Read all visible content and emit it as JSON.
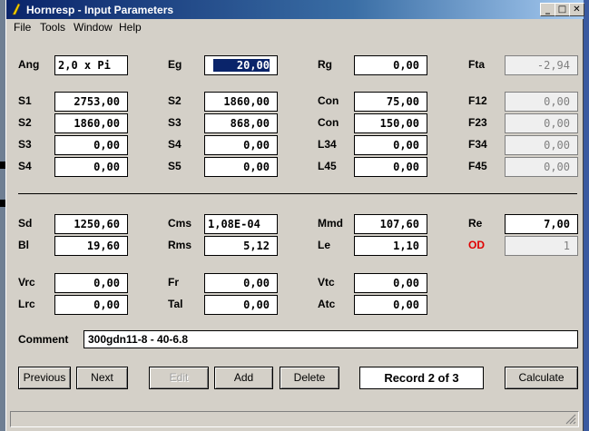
{
  "window": {
    "title": "Hornresp - Input Parameters",
    "buttons": {
      "minimize": "_",
      "maximize": "□",
      "close": "✕"
    }
  },
  "menu": [
    "File",
    "Tools",
    "Window",
    "Help"
  ],
  "params": {
    "ang": {
      "label": "Ang",
      "value": "2,0 x Pi"
    },
    "eg": {
      "label": "Eg",
      "value": "20,00"
    },
    "rg": {
      "label": "Rg",
      "value": "0,00"
    },
    "fta": {
      "label": "Fta",
      "value": "-2,94"
    },
    "s1": {
      "label": "S1",
      "value": "2753,00"
    },
    "s2a": {
      "label": "S2",
      "value": "1860,00"
    },
    "s2b": {
      "label": "S2",
      "value": "1860,00"
    },
    "s3a": {
      "label": "S3",
      "value": "868,00"
    },
    "s3b": {
      "label": "S3",
      "value": "0,00"
    },
    "s4a": {
      "label": "S4",
      "value": "0,00"
    },
    "s4b": {
      "label": "S4",
      "value": "0,00"
    },
    "s5": {
      "label": "S5",
      "value": "0,00"
    },
    "con1": {
      "label": "Con",
      "value": "75,00"
    },
    "con2": {
      "label": "Con",
      "value": "150,00"
    },
    "l34": {
      "label": "L34",
      "value": "0,00"
    },
    "l45": {
      "label": "L45",
      "value": "0,00"
    },
    "f12": {
      "label": "F12",
      "value": "0,00"
    },
    "f23": {
      "label": "F23",
      "value": "0,00"
    },
    "f34": {
      "label": "F34",
      "value": "0,00"
    },
    "f45": {
      "label": "F45",
      "value": "0,00"
    },
    "sd": {
      "label": "Sd",
      "value": "1250,60"
    },
    "bl": {
      "label": "Bl",
      "value": "19,60"
    },
    "cms": {
      "label": "Cms",
      "value": "1,08E-04"
    },
    "rms": {
      "label": "Rms",
      "value": "5,12"
    },
    "mmd": {
      "label": "Mmd",
      "value": "107,60"
    },
    "le": {
      "label": "Le",
      "value": "1,10"
    },
    "re": {
      "label": "Re",
      "value": "7,00"
    },
    "od": {
      "label": "OD",
      "value": "1"
    },
    "vrc": {
      "label": "Vrc",
      "value": "0,00"
    },
    "lrc": {
      "label": "Lrc",
      "value": "0,00"
    },
    "fr": {
      "label": "Fr",
      "value": "0,00"
    },
    "tal": {
      "label": "Tal",
      "value": "0,00"
    },
    "vtc": {
      "label": "Vtc",
      "value": "0,00"
    },
    "atc": {
      "label": "Atc",
      "value": "0,00"
    }
  },
  "comment": {
    "label": "Comment",
    "value": "300gdn11-8 - 40-6.8"
  },
  "buttons": {
    "previous": "Previous",
    "next": "Next",
    "edit": "Edit",
    "add": "Add",
    "delete": "Delete",
    "calculate": "Calculate"
  },
  "record": "Record 2 of 3",
  "colors": {
    "title_start": "#0a246a",
    "title_end": "#a6caf0",
    "od_label": "#e00000",
    "selection": "#0a246a"
  }
}
